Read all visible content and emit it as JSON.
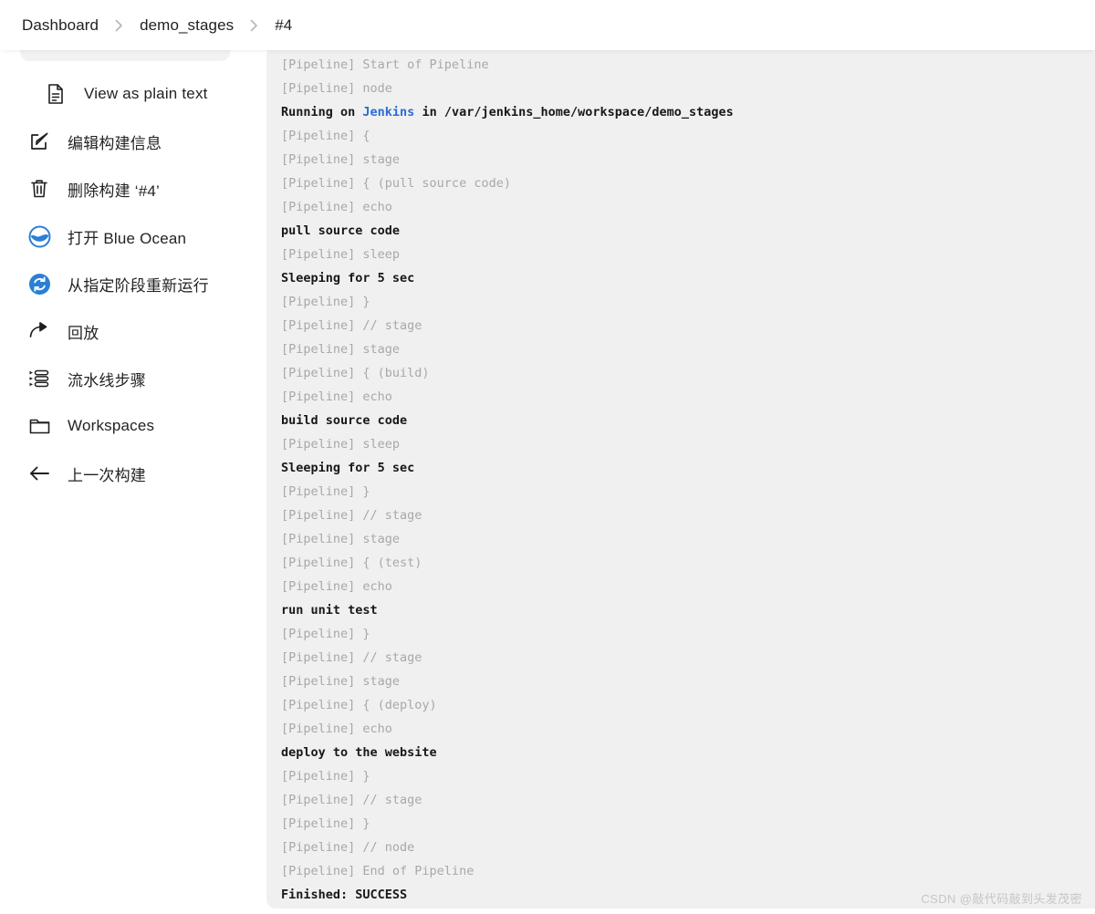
{
  "header": {
    "breadcrumb": [
      {
        "label": "Dashboard"
      },
      {
        "label": "demo_stages"
      },
      {
        "label": "#4"
      }
    ]
  },
  "sidebar": {
    "items": [
      {
        "label": "View as plain text",
        "icon": "document-icon"
      },
      {
        "label": "编辑构建信息",
        "icon": "edit-icon"
      },
      {
        "label": "删除构建 ‘#4’",
        "icon": "trash-icon"
      },
      {
        "label": "打开 Blue Ocean",
        "icon": "blue-ocean-icon"
      },
      {
        "label": "从指定阶段重新运行",
        "icon": "restart-icon"
      },
      {
        "label": "回放",
        "icon": "replay-icon"
      },
      {
        "label": "流水线步骤",
        "icon": "pipeline-steps-icon"
      },
      {
        "label": "Workspaces",
        "icon": "folder-icon"
      },
      {
        "label": "上一次构建",
        "icon": "arrow-left-icon"
      }
    ]
  },
  "console": {
    "lines": [
      {
        "type": "meta",
        "text": "[Pipeline] Start of Pipeline"
      },
      {
        "type": "meta",
        "text": "[Pipeline] node"
      },
      {
        "type": "out",
        "pre": "Running on ",
        "link": "Jenkins",
        "post": " in /var/jenkins_home/workspace/demo_stages"
      },
      {
        "type": "meta",
        "text": "[Pipeline] {"
      },
      {
        "type": "meta",
        "text": "[Pipeline] stage"
      },
      {
        "type": "meta",
        "text": "[Pipeline] { (pull source code)"
      },
      {
        "type": "meta",
        "text": "[Pipeline] echo"
      },
      {
        "type": "out",
        "text": "pull source code"
      },
      {
        "type": "meta",
        "text": "[Pipeline] sleep"
      },
      {
        "type": "out",
        "text": "Sleeping for 5 sec"
      },
      {
        "type": "meta",
        "text": "[Pipeline] }"
      },
      {
        "type": "meta",
        "text": "[Pipeline] // stage"
      },
      {
        "type": "meta",
        "text": "[Pipeline] stage"
      },
      {
        "type": "meta",
        "text": "[Pipeline] { (build)"
      },
      {
        "type": "meta",
        "text": "[Pipeline] echo"
      },
      {
        "type": "out",
        "text": "build source code"
      },
      {
        "type": "meta",
        "text": "[Pipeline] sleep"
      },
      {
        "type": "out",
        "text": "Sleeping for 5 sec"
      },
      {
        "type": "meta",
        "text": "[Pipeline] }"
      },
      {
        "type": "meta",
        "text": "[Pipeline] // stage"
      },
      {
        "type": "meta",
        "text": "[Pipeline] stage"
      },
      {
        "type": "meta",
        "text": "[Pipeline] { (test)"
      },
      {
        "type": "meta",
        "text": "[Pipeline] echo"
      },
      {
        "type": "out",
        "text": "run unit test"
      },
      {
        "type": "meta",
        "text": "[Pipeline] }"
      },
      {
        "type": "meta",
        "text": "[Pipeline] // stage"
      },
      {
        "type": "meta",
        "text": "[Pipeline] stage"
      },
      {
        "type": "meta",
        "text": "[Pipeline] { (deploy)"
      },
      {
        "type": "meta",
        "text": "[Pipeline] echo"
      },
      {
        "type": "out",
        "text": "deploy to the website"
      },
      {
        "type": "meta",
        "text": "[Pipeline] }"
      },
      {
        "type": "meta",
        "text": "[Pipeline] // stage"
      },
      {
        "type": "meta",
        "text": "[Pipeline] }"
      },
      {
        "type": "meta",
        "text": "[Pipeline] // node"
      },
      {
        "type": "meta",
        "text": "[Pipeline] End of Pipeline"
      },
      {
        "type": "out",
        "text": "Finished: SUCCESS"
      }
    ]
  },
  "watermark": {
    "text": "CSDN @敲代码敲到头发茂密"
  },
  "colors": {
    "link": "#2b6cd4",
    "console_bg": "#f0f0f0",
    "meta_text": "#a8a8a8",
    "out_text": "#16181c",
    "blue_ocean": "#2b7fd4"
  }
}
